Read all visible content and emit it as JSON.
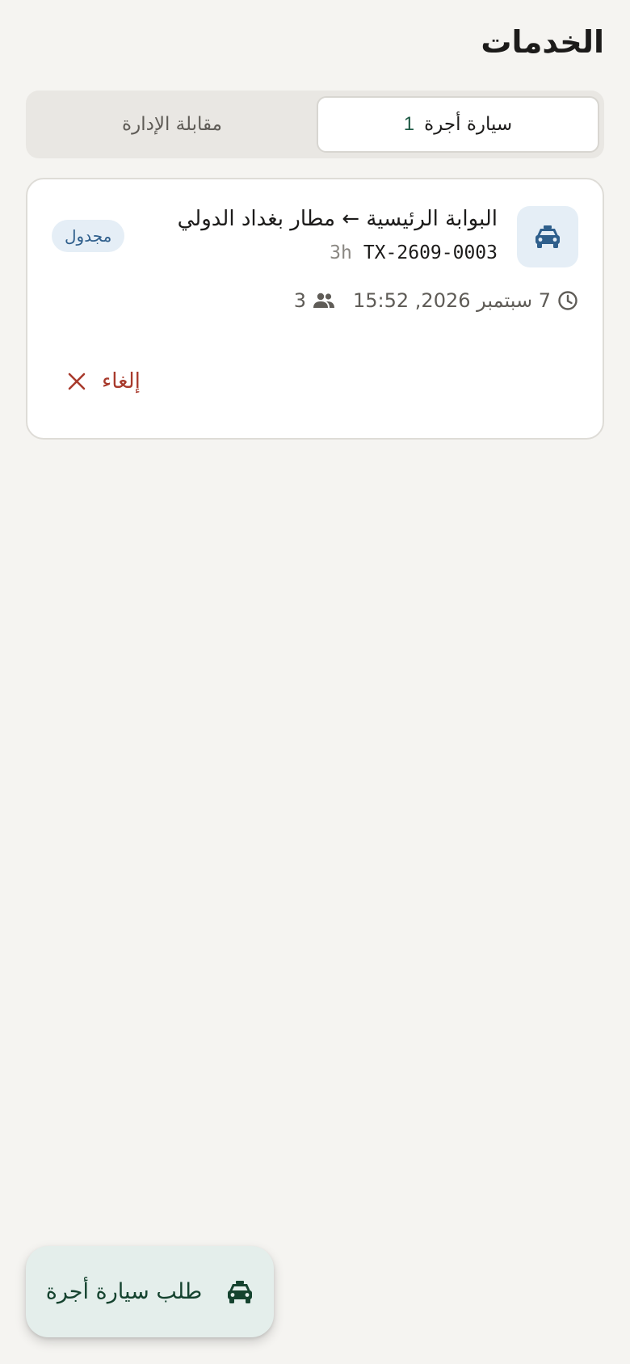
{
  "header": {
    "title": "الخدمات"
  },
  "tabs": {
    "taxi": {
      "label": "سيارة أجرة",
      "count": "1"
    },
    "meeting": {
      "label": "مقابلة الإدارة"
    }
  },
  "trip": {
    "title": "البوابة الرئيسية ← مطار بغداد الدولي",
    "id": "TX-2609-0003",
    "age": "3h",
    "status": "مجدول",
    "datetime": "7 سبتمبر 2026, 15:52",
    "passengers": "3",
    "cancel_label": "إلغاء"
  },
  "fab": {
    "label": "طلب سيارة أجرة"
  },
  "colors": {
    "background": "#f5f4f1",
    "accent_green": "#1f5a45",
    "status_blue": "#2f5f8c",
    "cancel_red": "#a83a2c"
  },
  "icons": {
    "trip": "taxi-icon",
    "time": "clock-icon",
    "passengers": "people-icon",
    "cancel": "close-icon",
    "fab": "taxi-icon"
  }
}
